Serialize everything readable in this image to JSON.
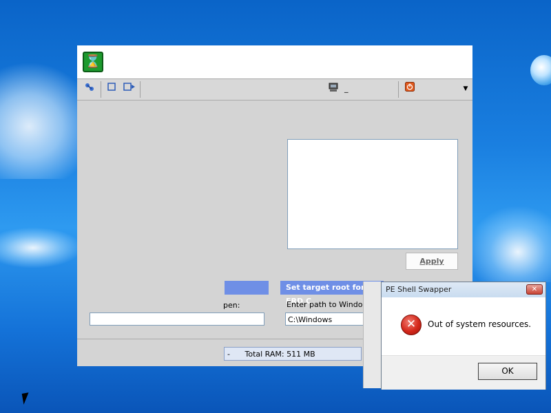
{
  "toolbar": {
    "left_icons": [
      "network-icon",
      "square-icon",
      "record-icon"
    ],
    "center_icon": "computer-icon",
    "center_label": "_",
    "right_icon": "power-icon",
    "dropdown_icon": "chevron-down-icon"
  },
  "main": {
    "apply_label": "Apply",
    "left_group": {
      "header": "",
      "label_fragment": "pen:",
      "input_value": ""
    },
    "right_group": {
      "header": "Set target root for ERD C",
      "label": "Enter path to Windows insta",
      "input_value": "C:\\Windows"
    },
    "status": {
      "dash": "-",
      "ram_text": "Total RAM: 511 MB"
    }
  },
  "dialog": {
    "title": "PE Shell Swapper",
    "close_symbol": "✕",
    "icon": "error-icon",
    "message": "Out of system resources.",
    "ok_label": "OK"
  },
  "colors": {
    "group_header": "#6f8fe6",
    "error_red": "#d4281b",
    "desktop_blue": "#1a7fe0"
  }
}
